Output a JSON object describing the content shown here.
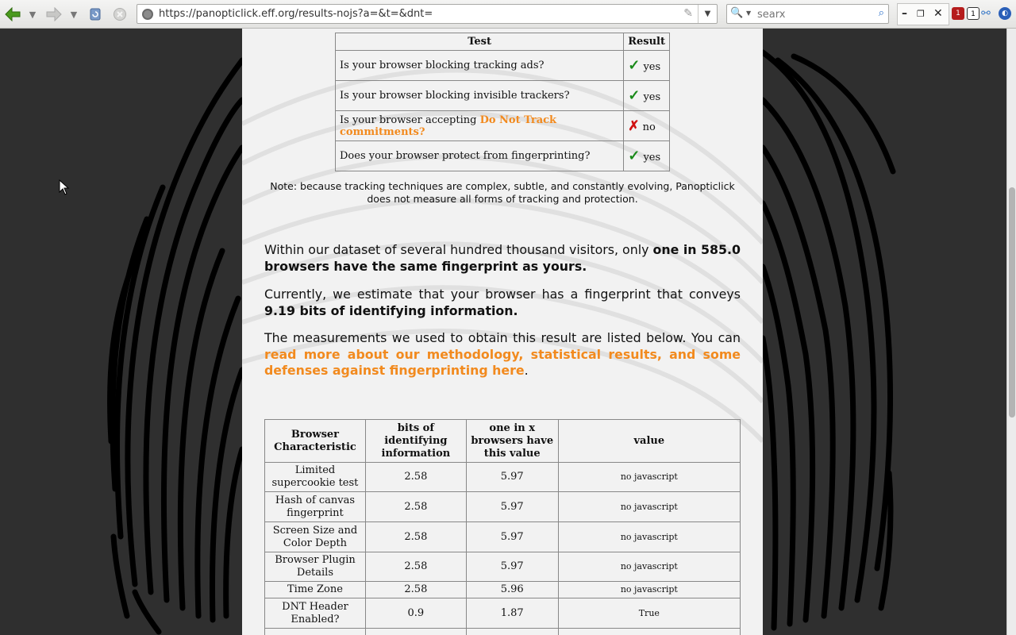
{
  "browser": {
    "url": "https://panopticlick.eff.org/results-nojs?a=&t=&dnt=",
    "search_placeholder": "searx",
    "addon_badge": "1",
    "addon_badge2": "1"
  },
  "results_table": {
    "header_test": "Test",
    "header_result": "Result",
    "rows": [
      {
        "question": "Is your browser blocking tracking ads?",
        "link": "",
        "mark": "✓",
        "answer": "yes"
      },
      {
        "question": "Is your browser blocking invisible trackers?",
        "link": "",
        "mark": "✓",
        "answer": "yes"
      },
      {
        "question": "Is your browser accepting ",
        "link": "Do Not Track commitments?",
        "mark": "✗",
        "answer": "no"
      },
      {
        "question": "Does your browser protect from fingerprinting?",
        "link": "",
        "mark": "✓",
        "answer": "yes"
      }
    ]
  },
  "note": "Note: because tracking techniques are complex, subtle, and constantly evolving, Panopticlick does not measure all forms of tracking and protection.",
  "summary": {
    "p1_prefix": "Within our dataset of several hundred thousand visitors, only ",
    "p1_bold": "one in 585.0 browsers have the same fingerprint as yours.",
    "p2_prefix": "Currently, we estimate that your browser has a fingerprint that conveys ",
    "p2_bold": "9.19 bits of identifying information.",
    "p3_prefix": "The measurements we used to obtain this result are listed below. You can ",
    "p3_link": "read more about our methodology, statistical results, and some defenses against fingerprinting here",
    "p3_suffix": "."
  },
  "fingerprint_table": {
    "headers": [
      "Browser Characteristic",
      "bits of identifying information",
      "one in x browsers have this value",
      "value"
    ],
    "rows": [
      {
        "name": "Limited supercookie test",
        "bits": "2.58",
        "one_in": "5.97",
        "value": "no javascript"
      },
      {
        "name": "Hash of canvas fingerprint",
        "bits": "2.58",
        "one_in": "5.97",
        "value": "no javascript"
      },
      {
        "name": "Screen Size and Color Depth",
        "bits": "2.58",
        "one_in": "5.97",
        "value": "no javascript"
      },
      {
        "name": "Browser Plugin Details",
        "bits": "2.58",
        "one_in": "5.97",
        "value": "no javascript"
      },
      {
        "name": "Time Zone",
        "bits": "2.58",
        "one_in": "5.96",
        "value": "no javascript"
      },
      {
        "name": "DNT Header Enabled?",
        "bits": "0.9",
        "one_in": "1.87",
        "value": "True"
      }
    ]
  }
}
